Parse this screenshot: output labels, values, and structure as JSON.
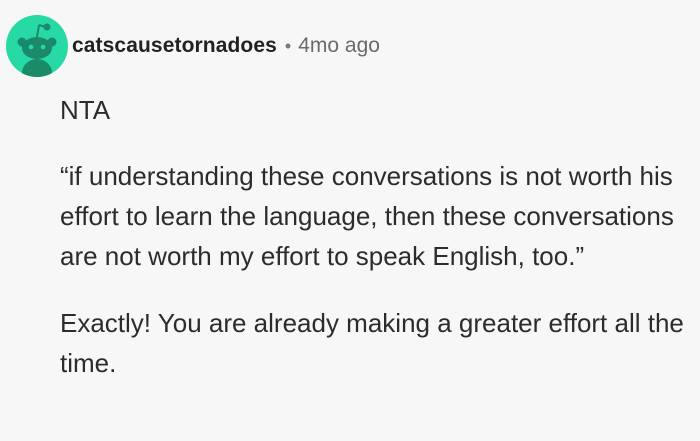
{
  "comment": {
    "username": "catscausetornadoes",
    "separator": "•",
    "timestamp": "4mo ago",
    "avatar_icon": "reddit-snoo-avatar-icon",
    "avatar_color": "#27d9a5",
    "paragraphs": [
      "NTA",
      "“if understanding these conversations is not worth his effort to learn the language, then these conversations are not worth my effort to speak English, too.”",
      "Exactly! You are already making a greater effort all the time."
    ]
  }
}
